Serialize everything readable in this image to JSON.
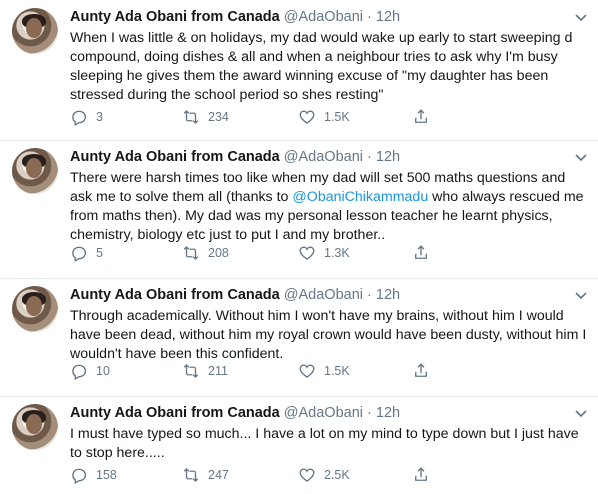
{
  "tweets": [
    {
      "name": "Aunty Ada Obani from Canada",
      "handle": "@AdaObani",
      "time": "12h",
      "text_a": "When I was little & on holidays, my dad would wake up early to start sweeping d compound, doing dishes & all and when a neighbour tries to ask why I'm busy sleeping he gives them the award winning excuse of \"my daughter has been stressed during the school period so shes resting\"",
      "mention": "",
      "text_b": "",
      "replies": "3",
      "retweets": "234",
      "likes": "1.5K"
    },
    {
      "name": "Aunty Ada Obani from Canada",
      "handle": "@AdaObani",
      "time": "12h",
      "text_a": "There were harsh times too like when my dad will set 500 maths questions and ask me to solve them all (thanks to ",
      "mention": "@ObaniChikammadu",
      "text_b": " who always rescued me from maths then). My dad was my personal lesson teacher he learnt physics, chemistry, biology etc just to put I and my brother..",
      "replies": "5",
      "retweets": "208",
      "likes": "1.3K"
    },
    {
      "name": "Aunty Ada Obani from Canada",
      "handle": "@AdaObani",
      "time": "12h",
      "text_a": "Through academically. Without him I won't have my brains, without him I would have been dead, without him my royal crown would have been dusty, without him I wouldn't have been this confident.",
      "mention": "",
      "text_b": "",
      "replies": "10",
      "retweets": "211",
      "likes": "1.5K"
    },
    {
      "name": "Aunty Ada Obani from Canada",
      "handle": "@AdaObani",
      "time": "12h",
      "text_a": "I must have typed so much... I have a lot on my mind to type down but I just have to stop here.....",
      "mention": "",
      "text_b": "",
      "replies": "158",
      "retweets": "247",
      "likes": "2.5K"
    }
  ],
  "separator": "·",
  "icons": {
    "reply": "reply-icon",
    "retweet": "retweet-icon",
    "like": "heart-icon",
    "share": "share-icon",
    "menu": "chevron-down-icon"
  },
  "colors": {
    "text": "#14171a",
    "muted": "#657786",
    "link": "#1b95e0",
    "divider": "#e6ecf0"
  }
}
